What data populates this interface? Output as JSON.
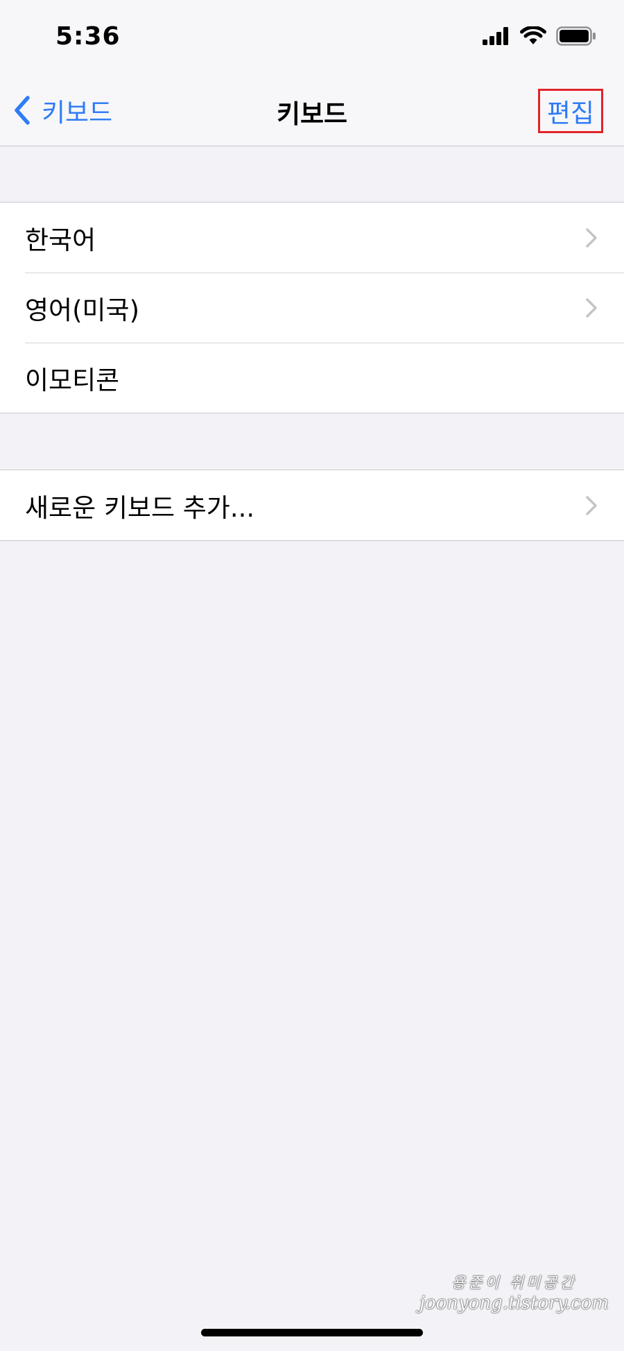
{
  "status_bar": {
    "time": "5:36",
    "icons": [
      "signal-icon",
      "wifi-icon",
      "battery-icon"
    ]
  },
  "nav": {
    "back_label": "키보드",
    "title": "키보드",
    "edit_label": "편집"
  },
  "keyboards": [
    {
      "label": "한국어",
      "has_chevron": true
    },
    {
      "label": "영어(미국)",
      "has_chevron": true
    },
    {
      "label": "이모티콘",
      "has_chevron": false
    }
  ],
  "add_keyboard": {
    "label": "새로운 키보드 추가..."
  },
  "watermark": {
    "line1": "용준이 취미공간",
    "line2": "joonyong.tistory.com"
  },
  "colors": {
    "accent": "#2f7cf6",
    "highlight_box": "#e2232a",
    "background": "#f2f2f7"
  }
}
